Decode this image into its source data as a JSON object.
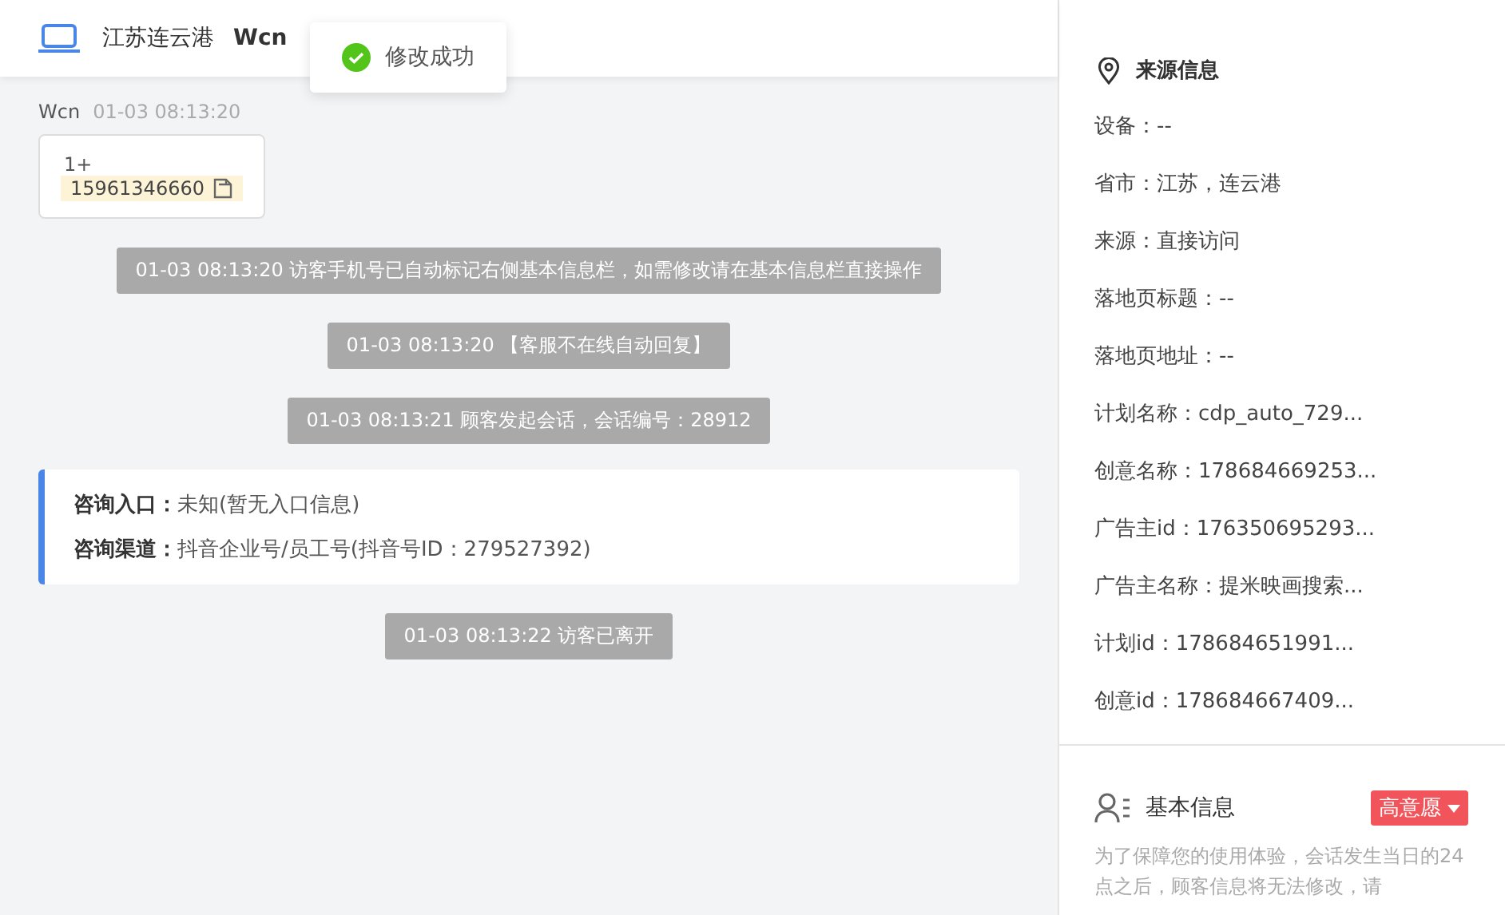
{
  "header": {
    "location": "江苏连云港",
    "visitor": "Wcn"
  },
  "toast": {
    "text": "修改成功"
  },
  "chat": {
    "sender": "Wcn",
    "time": "01-03 08:13:20",
    "phone_prefix": "1+",
    "phone": "15961346660",
    "events": [
      {
        "kind": "system",
        "text": "01-03 08:13:20 访客手机号已自动标记右侧基本信息栏，如需修改请在基本信息栏直接操作"
      },
      {
        "kind": "system",
        "text": "01-03 08:13:20 【客服不在线自动回复】"
      },
      {
        "kind": "system",
        "text": "01-03 08:13:21 顾客发起会话，会话编号：28912"
      },
      {
        "kind": "info",
        "rows": [
          {
            "label": "咨询入口：",
            "value": "未知(暂无入口信息)"
          },
          {
            "label": "咨询渠道：",
            "value": "抖音企业号/员工号(抖音号ID：279527392)"
          }
        ]
      },
      {
        "kind": "system",
        "text": "01-03 08:13:22 访客已离开"
      }
    ]
  },
  "source_info": {
    "title": "来源信息",
    "rows": [
      "设备：--",
      "省市：江苏，连云港",
      "来源：直接访问",
      "落地页标题：--",
      "落地页地址：--",
      "计划名称：cdp_auto_729...",
      "创意名称：178684669253...",
      "广告主id：176350695293...",
      "广告主名称：提米映画搜索...",
      "计划id：178684651991...",
      "创意id：178684667409..."
    ]
  },
  "basic_info": {
    "title": "基本信息",
    "intent_tag": "高意愿",
    "note": "为了保障您的使用体验，会话发生当日的24点之后，顾客信息将无法修改，请"
  }
}
